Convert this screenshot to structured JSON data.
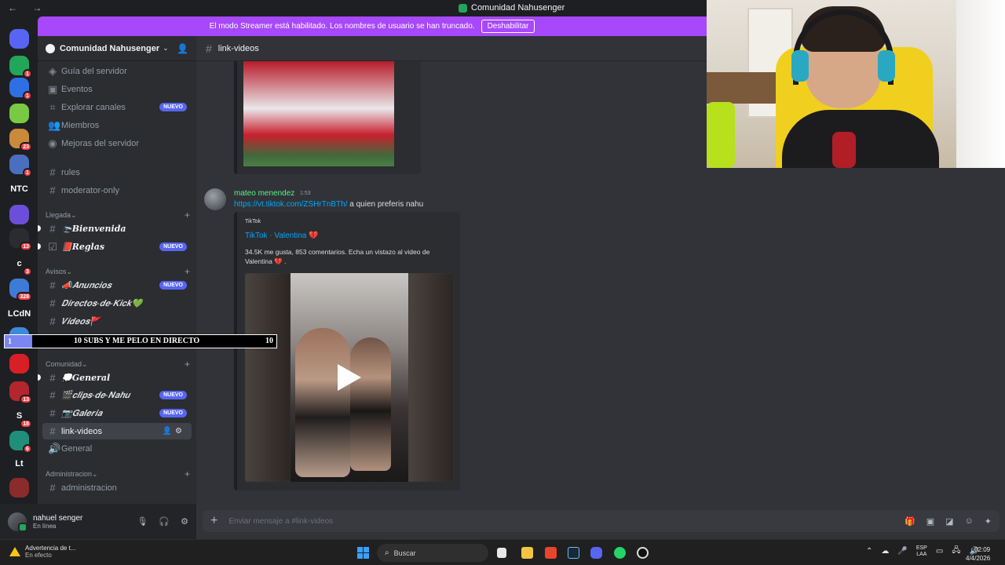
{
  "window": {
    "title": "Comunidad Nahusenger",
    "nav_arrows": "←  →"
  },
  "banner": {
    "text": "El modo Streamer está habilitado. Los nombres de usuario se han truncado.",
    "button": "Deshabilitar"
  },
  "rail": {
    "servers": [
      {
        "label": "",
        "badge": "",
        "color": "#5865f2",
        "icon": "discord-home-icon"
      },
      {
        "label": "",
        "badge": "1",
        "color": "#23a55a",
        "icon": "server-icon"
      },
      {
        "label": "",
        "badge": "1",
        "color": "#2f6fe4",
        "icon": "server-icon"
      },
      {
        "label": "",
        "badge": "",
        "color": "#7ac943",
        "icon": "server-icon"
      },
      {
        "label": "",
        "badge": "23",
        "color": "#c98a3a",
        "icon": "server-icon"
      },
      {
        "label": "",
        "badge": "1",
        "color": "#4a6fbf",
        "icon": "server-icon"
      },
      {
        "label": "NTC",
        "badge": "",
        "color": "transparent",
        "icon": "server-text"
      },
      {
        "label": "",
        "badge": "",
        "color": "#6b4fd8",
        "icon": "server-icon"
      },
      {
        "label": "",
        "badge": "13",
        "color": "#2a2c31",
        "icon": "server-icon"
      },
      {
        "label": "c",
        "badge": "3",
        "color": "transparent",
        "icon": "server-text"
      },
      {
        "label": "",
        "badge": "328",
        "color": "#3e7bd6",
        "icon": "server-icon"
      },
      {
        "label": "LCdN",
        "badge": "",
        "color": "transparent",
        "icon": "server-text"
      },
      {
        "label": "",
        "badge": "",
        "color": "#3c8ad9",
        "icon": "server-icon"
      },
      {
        "label": "",
        "badge": "",
        "color": "#d81f26",
        "icon": "server-icon"
      },
      {
        "label": "",
        "badge": "13",
        "color": "#b3262d",
        "icon": "server-icon"
      },
      {
        "label": "S",
        "badge": "18",
        "color": "transparent",
        "icon": "server-text"
      },
      {
        "label": "",
        "badge": "6",
        "color": "#1f8f7a",
        "icon": "server-icon"
      },
      {
        "label": "Lt",
        "badge": "",
        "color": "transparent",
        "icon": "server-text"
      },
      {
        "label": "",
        "badge": "",
        "color": "#8a2c2c",
        "icon": "server-icon"
      }
    ],
    "nuevo_badge": "NUEVO"
  },
  "sidebar": {
    "server_name": "Comunidad Nahusenger",
    "top_items": [
      {
        "label": "Guía del servidor",
        "icon": "guide-icon",
        "tag": ""
      },
      {
        "label": "Eventos",
        "icon": "calendar-icon",
        "tag": ""
      },
      {
        "label": "Explorar canales",
        "icon": "browse-channels-icon",
        "tag": "NUEVO"
      },
      {
        "label": "Miembros",
        "icon": "members-icon",
        "tag": ""
      },
      {
        "label": "Mejoras del servidor",
        "icon": "boost-icon",
        "tag": ""
      }
    ],
    "channels_a": [
      {
        "label": "rules",
        "sym": "#",
        "tag": ""
      },
      {
        "label": "moderator-only",
        "sym": "#",
        "tag": ""
      }
    ],
    "cat_llegada": "Llegada",
    "channels_llegada": [
      {
        "label": "🛬𝑩𝒊𝒆𝒏𝒗𝒆𝒏𝒊𝒅𝒂",
        "sym": "#",
        "tag": ""
      },
      {
        "label": "📕𝑹𝒆𝒈𝒍𝒂𝒔",
        "sym": "☑",
        "tag": "NUEVO"
      }
    ],
    "cat_avisos": "Avisos",
    "channels_avisos": [
      {
        "label": "📣𝑨𝒏𝒖𝒏𝒄𝒊𝒐𝒔",
        "sym": "#",
        "tag": "NUEVO"
      },
      {
        "label": "𝑫𝒊𝒓𝒆𝒄𝒕𝒐𝒔-𝒅𝒆-𝑲𝒊𝒄𝒌💚",
        "sym": "#",
        "tag": ""
      },
      {
        "label": "𝑽𝒊𝒅𝒆𝒐𝒔🚩",
        "sym": "#",
        "tag": ""
      },
      {
        "label": "🎬",
        "sym": "#",
        "tag": ""
      }
    ],
    "cat_comunidad": "Comunidad",
    "channels_comunidad": [
      {
        "label": "💭𝑮𝒆𝒏𝒆𝒓𝒂𝒍",
        "sym": "#",
        "tag": ""
      },
      {
        "label": "🎬𝒄𝒍𝒊𝒑𝒔-𝒅𝒆-𝑵𝒂𝒉𝒖",
        "sym": "#",
        "tag": "NUEVO"
      },
      {
        "label": "📷𝑮𝒂𝒍𝒆𝒓𝒊𝒂",
        "sym": "#",
        "tag": "NUEVO"
      },
      {
        "label": "link-videos",
        "sym": "#",
        "tag": ""
      },
      {
        "label": "General",
        "sym": "🔊",
        "tag": ""
      }
    ],
    "cat_admin": "Administracion",
    "channels_admin": [
      {
        "label": "administracion",
        "sym": "#",
        "tag": ""
      }
    ]
  },
  "user": {
    "name": "nahuel senger",
    "status": "En línea"
  },
  "chat": {
    "channel": "link-videos",
    "message": {
      "author": "mateo menendez",
      "time": "1:53",
      "link": "https://vt.tiktok.com/ZSHrTnBTh/",
      "text": " a quien preferis nahu"
    },
    "embed": {
      "provider": "TikTok",
      "title": "TikTok · Valentina 💔",
      "description": "34.5K me gusta, 853 comentarios. Echa un vistazo al video de Valentina 💔 ."
    },
    "composer_placeholder": "Enviar mensaje a #link-videos"
  },
  "goal_overlay": {
    "current": "1",
    "text": "10 SUBS Y ME PELO EN DIRECTO",
    "target": "10",
    "progress": 0.1
  },
  "taskbar": {
    "warning_title": "Advertencia de t...",
    "warning_sub": "En efecto",
    "search": "Buscar",
    "lang_1": "ESP",
    "lang_2": "LAA",
    "time": "02:09",
    "date": "4/4/2026"
  },
  "colors": {
    "accent": "#5865f2",
    "streamer_banner": "#a748fb",
    "link": "#00a8fc",
    "author": "#57f287"
  }
}
